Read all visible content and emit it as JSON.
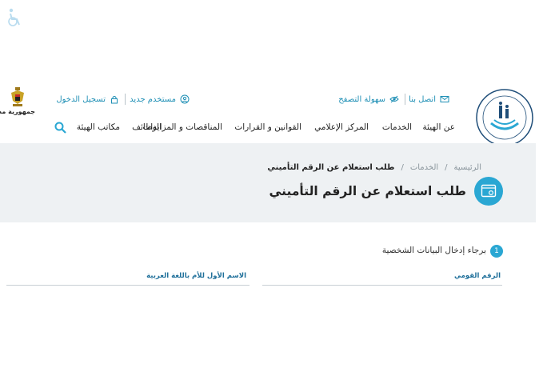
{
  "brand": {
    "country_label": "جمهورية مصر"
  },
  "utility": {
    "contact": "اتصل بنا",
    "accessibility": "سهولة التصفح",
    "new_user": "مستخدم جديد",
    "login": "تسجيل الدخول"
  },
  "nav": {
    "items": [
      "عن الهيئة",
      "الخدمات",
      "المركز الإعلامي",
      "القوانين و القرارات",
      "المناقصات و المزايدات",
      "الوظائف",
      "مكاتب الهيئة"
    ]
  },
  "breadcrumb": {
    "home": "الرئيسية",
    "sep": "/",
    "services": "الخدمات",
    "current": "طلب استعلام عن الرقم التأميني"
  },
  "page": {
    "title": "طلب استعلام عن الرقم التأميني"
  },
  "form": {
    "step_number": "1",
    "step_title": "برجاء إدخال البيانات الشخصية",
    "national_id_label": "الرقم القومي",
    "mother_name_label": "الاسم الأول للأم باللغة العربية"
  },
  "colors": {
    "accent": "#2aa7d3",
    "band": "#eef1f3"
  }
}
